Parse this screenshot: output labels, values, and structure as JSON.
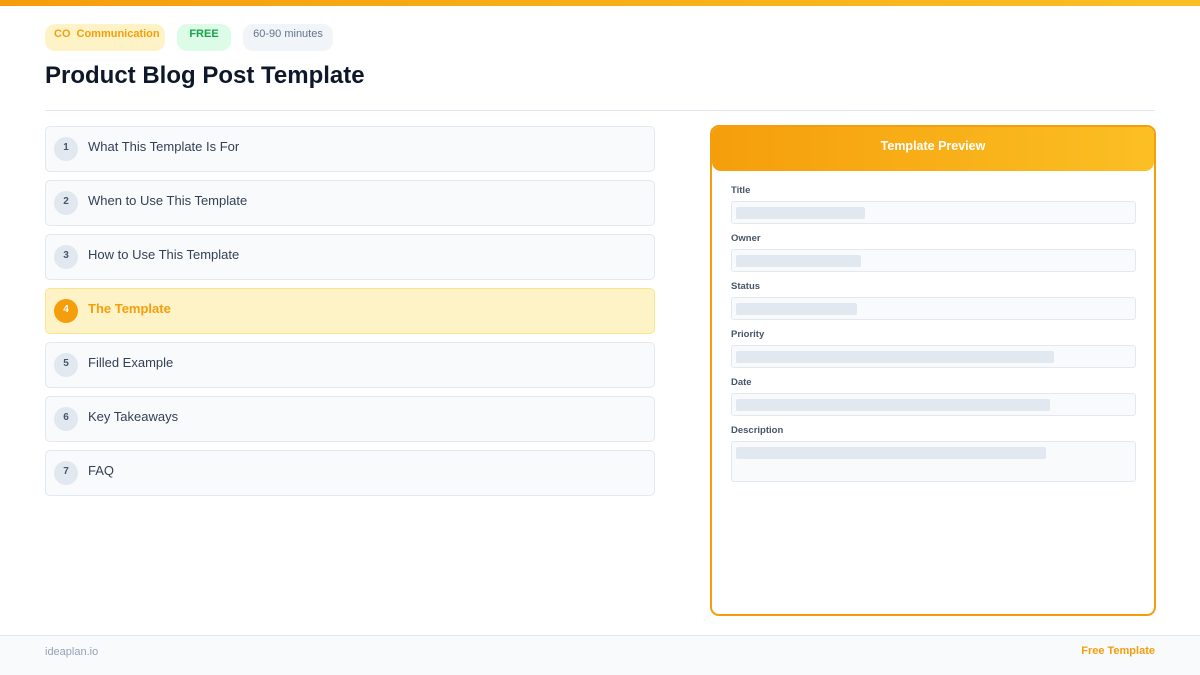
{
  "badges": {
    "category_abbr": "CO",
    "category": "Communication",
    "price": "FREE",
    "duration": "60-90 minutes"
  },
  "page": {
    "title": "Product Blog Post Template"
  },
  "sections": [
    {
      "num": "1",
      "label": "What This Template Is For",
      "active": false
    },
    {
      "num": "2",
      "label": "When to Use This Template",
      "active": false
    },
    {
      "num": "3",
      "label": "How to Use This Template",
      "active": false
    },
    {
      "num": "4",
      "label": "The Template",
      "active": true
    },
    {
      "num": "5",
      "label": "Filled Example",
      "active": false
    },
    {
      "num": "6",
      "label": "Key Takeaways",
      "active": false
    },
    {
      "num": "7",
      "label": "FAQ",
      "active": false
    }
  ],
  "preview": {
    "header": "Template Preview",
    "fields": [
      {
        "label": "Title",
        "fill": 0.32
      },
      {
        "label": "Owner",
        "fill": 0.31
      },
      {
        "label": "Status",
        "fill": 0.3
      },
      {
        "label": "Priority",
        "fill": 0.79
      },
      {
        "label": "Date",
        "fill": 0.78
      },
      {
        "label": "Description",
        "fill": 0.77
      }
    ]
  },
  "footer": {
    "brand": "ideaplan.io",
    "tag": "Free Template"
  },
  "colors": {
    "accent": "#f59e0b",
    "accent_light": "#fef3c7",
    "success": "#16a34a"
  }
}
